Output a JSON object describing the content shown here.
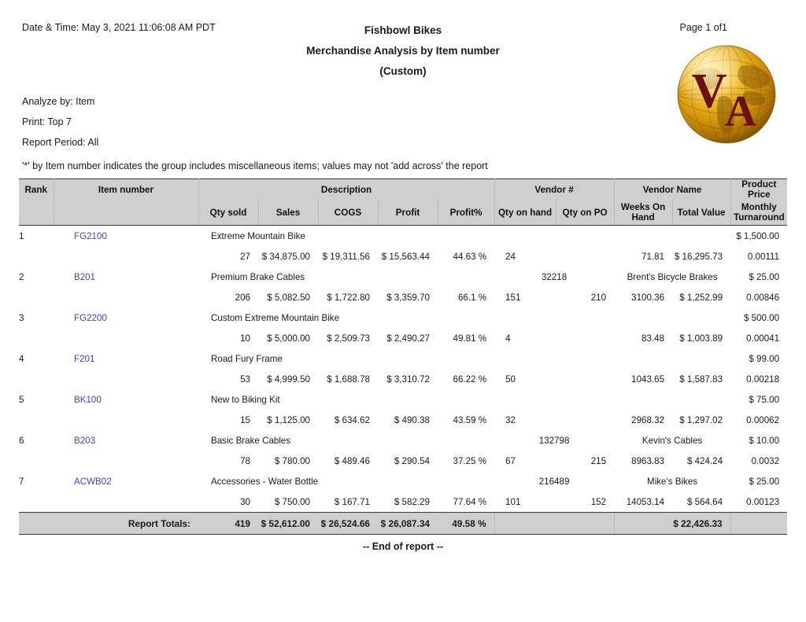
{
  "header": {
    "datetime": "Date & Time: May 3, 2021 11:06:08 AM PDT",
    "company": "Fishbowl Bikes",
    "report_title": "Merchandise Analysis by Item number",
    "subtitle": "(Custom)",
    "page_label": "Page 1 of1",
    "logo_letter_1": "V",
    "logo_letter_2": "A"
  },
  "meta": {
    "analyze_by": "Analyze by: Item",
    "print": "Print: Top 7",
    "report_period": "Report Period: All",
    "note": "'*' by Item number indicates the group includes miscellaneous items; values may not 'add across' the report"
  },
  "table": {
    "header_row1": {
      "rank": "Rank",
      "item_number": "Item number",
      "description": "Description",
      "vendor_num": "Vendor #",
      "vendor_name": "Vendor Name",
      "product_price": "Product Price"
    },
    "header_row2": {
      "qty_sold": "Qty sold",
      "sales": "Sales",
      "cogs": "COGS",
      "profit": "Profit",
      "profit_pct": "Profit%",
      "qty_on_hand": "Qty on hand",
      "qty_on_po": "Qty on PO",
      "weeks_on_hand_l1": "Weeks On",
      "weeks_on_hand_l2": "Hand",
      "total_value": "Total Value",
      "monthly_turnaround_l1": "Monthly",
      "monthly_turnaround_l2": "Turnaround"
    },
    "rows": [
      {
        "rank": "1",
        "item_number": "FG2100",
        "description": "Extreme Mountain Bike",
        "vendor_num": "",
        "vendor_name": "",
        "product_price": "$ 1,500.00",
        "qty_sold": "27",
        "sales": "$ 34,875.00",
        "cogs": "$ 19,311.56",
        "profit": "$ 15,563.44",
        "profit_pct": "44.63 %",
        "qty_on_hand": "24",
        "qty_on_po": "",
        "weeks_on_hand": "71.81",
        "total_value": "$ 16,295.73",
        "monthly_turnaround": "0.00111"
      },
      {
        "rank": "2",
        "item_number": "B201",
        "description": "Premium Brake Cables",
        "vendor_num": "32218",
        "vendor_name": "Brent's Bicycle Brakes",
        "product_price": "$ 25.00",
        "qty_sold": "206",
        "sales": "$ 5,082.50",
        "cogs": "$ 1,722.80",
        "profit": "$ 3,359.70",
        "profit_pct": "66.1 %",
        "qty_on_hand": "151",
        "qty_on_po": "210",
        "weeks_on_hand": "3100.36",
        "total_value": "$ 1,252.99",
        "monthly_turnaround": "0.00846"
      },
      {
        "rank": "3",
        "item_number": "FG2200",
        "description": "Custom Extreme Mountain Bike",
        "vendor_num": "",
        "vendor_name": "",
        "product_price": "$ 500.00",
        "qty_sold": "10",
        "sales": "$ 5,000.00",
        "cogs": "$ 2,509.73",
        "profit": "$ 2,490.27",
        "profit_pct": "49.81 %",
        "qty_on_hand": "4",
        "qty_on_po": "",
        "weeks_on_hand": "83.48",
        "total_value": "$ 1,003.89",
        "monthly_turnaround": "0.00041"
      },
      {
        "rank": "4",
        "item_number": "F201",
        "description": "Road Fury Frame",
        "vendor_num": "",
        "vendor_name": "",
        "product_price": "$ 99.00",
        "qty_sold": "53",
        "sales": "$ 4,999.50",
        "cogs": "$ 1,688.78",
        "profit": "$ 3,310.72",
        "profit_pct": "66.22 %",
        "qty_on_hand": "50",
        "qty_on_po": "",
        "weeks_on_hand": "1043.65",
        "total_value": "$ 1,587.83",
        "monthly_turnaround": "0.00218"
      },
      {
        "rank": "5",
        "item_number": "BK100",
        "description": "New to Biking Kit",
        "vendor_num": "",
        "vendor_name": "",
        "product_price": "$ 75.00",
        "qty_sold": "15",
        "sales": "$ 1,125.00",
        "cogs": "$ 634.62",
        "profit": "$ 490.38",
        "profit_pct": "43.59 %",
        "qty_on_hand": "32",
        "qty_on_po": "",
        "weeks_on_hand": "2968.32",
        "total_value": "$ 1,297.02",
        "monthly_turnaround": "0.00062"
      },
      {
        "rank": "6",
        "item_number": "B203",
        "description": "Basic Brake Cables",
        "vendor_num": "132798",
        "vendor_name": "Kevin's Cables",
        "product_price": "$ 10.00",
        "qty_sold": "78",
        "sales": "$ 780.00",
        "cogs": "$ 489.46",
        "profit": "$ 290.54",
        "profit_pct": "37.25 %",
        "qty_on_hand": "67",
        "qty_on_po": "215",
        "weeks_on_hand": "8963.83",
        "total_value": "$ 424.24",
        "monthly_turnaround": "0.0032"
      },
      {
        "rank": "7",
        "item_number": "ACWB02",
        "description": "Accessories - Water Bottle",
        "vendor_num": "216489",
        "vendor_name": "Mike's Bikes",
        "product_price": "$ 25.00",
        "qty_sold": "30",
        "sales": "$ 750.00",
        "cogs": "$ 167.71",
        "profit": "$ 582.29",
        "profit_pct": "77.64 %",
        "qty_on_hand": "101",
        "qty_on_po": "152",
        "weeks_on_hand": "14053.14",
        "total_value": "$ 564.64",
        "monthly_turnaround": "0.00123"
      }
    ],
    "totals": {
      "label": "Report Totals:",
      "qty_sold": "419",
      "sales": "$ 52,612.00",
      "cogs": "$ 26,524.66",
      "profit": "$ 26,087.34",
      "profit_pct": "49.58 %",
      "total_value": "$ 22,426.33"
    }
  },
  "footer": {
    "end_of_report": "-- End of report --"
  },
  "colors": {
    "header_band": "#cfcfcf",
    "link": "#4141c8",
    "rule": "#3a3a3a",
    "logo_gold": "#d9a21b",
    "logo_letters": "#6b1111"
  }
}
